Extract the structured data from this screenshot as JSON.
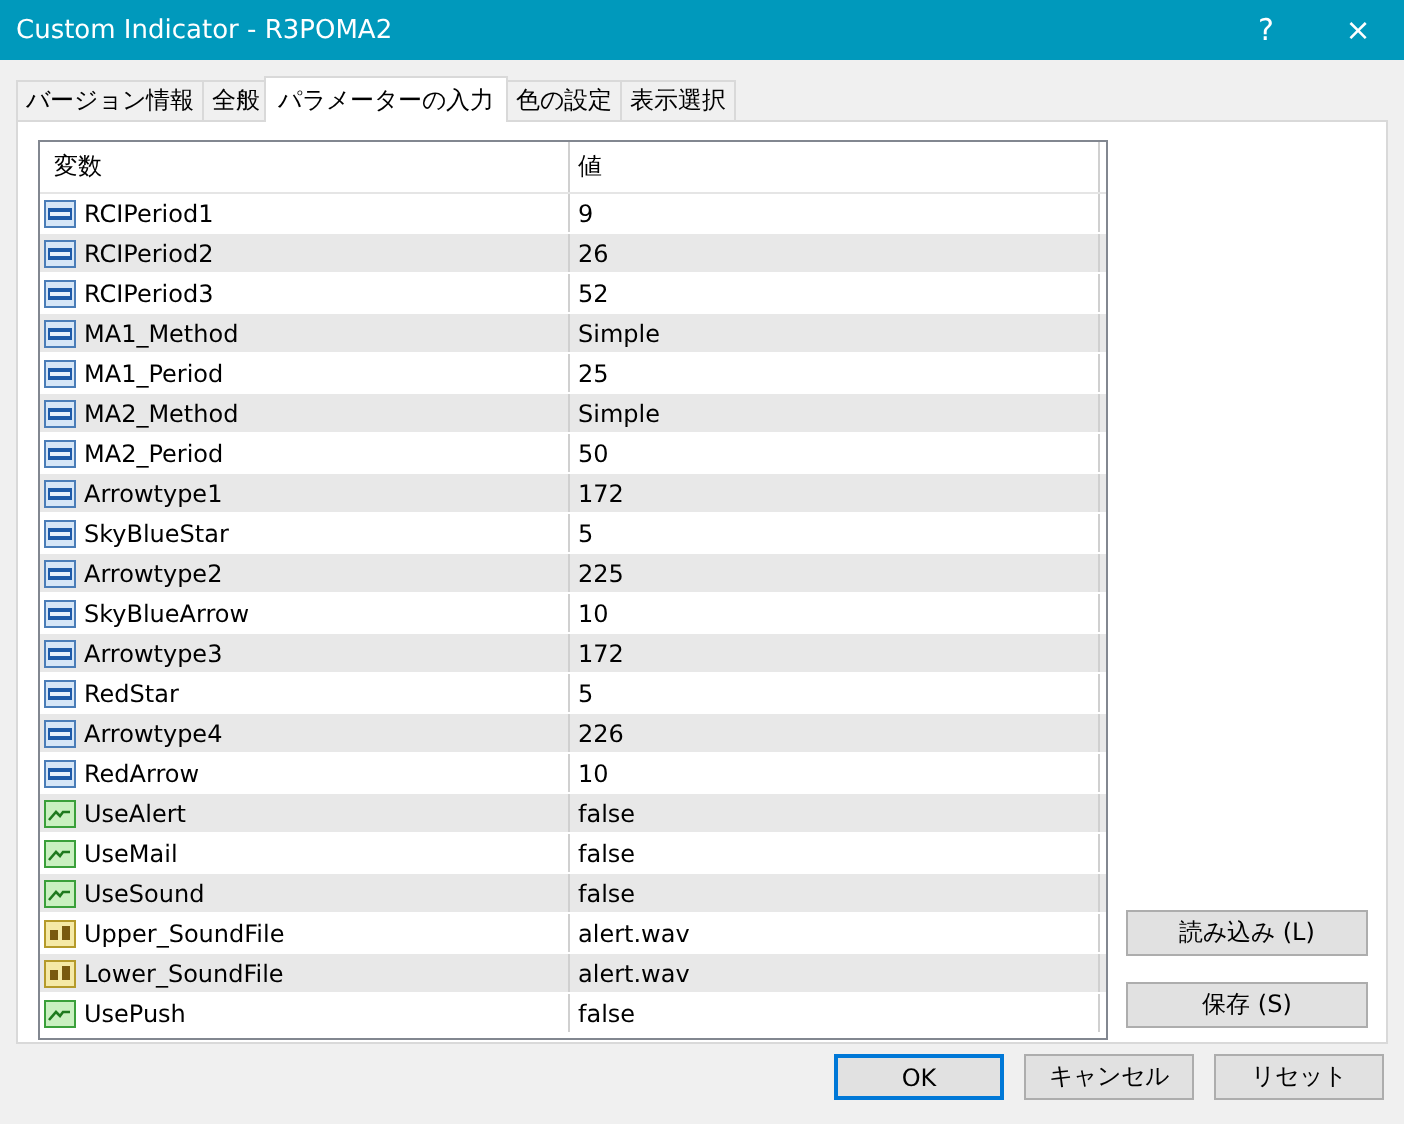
{
  "window": {
    "title": "Custom Indicator - R3POMA2",
    "help": "?",
    "close": "×"
  },
  "tabs": [
    {
      "label": "バージョン情報",
      "selected": false
    },
    {
      "label": "全般",
      "selected": false
    },
    {
      "label": "パラメーターの入力",
      "selected": true
    },
    {
      "label": "色の設定",
      "selected": false
    },
    {
      "label": "表示選択",
      "selected": false
    }
  ],
  "table": {
    "columns": [
      "変数",
      "値"
    ],
    "rows": [
      {
        "kind": "number",
        "name": "RCIPeriod1",
        "value": "9"
      },
      {
        "kind": "number",
        "name": "RCIPeriod2",
        "value": "26"
      },
      {
        "kind": "number",
        "name": "RCIPeriod3",
        "value": "52"
      },
      {
        "kind": "number",
        "name": "MA1_Method",
        "value": "Simple"
      },
      {
        "kind": "number",
        "name": "MA1_Period",
        "value": "25"
      },
      {
        "kind": "number",
        "name": "MA2_Method",
        "value": "Simple"
      },
      {
        "kind": "number",
        "name": "MA2_Period",
        "value": "50"
      },
      {
        "kind": "number",
        "name": "Arrowtype1",
        "value": "172"
      },
      {
        "kind": "number",
        "name": "SkyBlueStar",
        "value": "5"
      },
      {
        "kind": "number",
        "name": "Arrowtype2",
        "value": "225"
      },
      {
        "kind": "number",
        "name": "SkyBlueArrow",
        "value": "10"
      },
      {
        "kind": "number",
        "name": "Arrowtype3",
        "value": "172"
      },
      {
        "kind": "number",
        "name": "RedStar",
        "value": "5"
      },
      {
        "kind": "number",
        "name": "Arrowtype4",
        "value": "226"
      },
      {
        "kind": "number",
        "name": "RedArrow",
        "value": "10"
      },
      {
        "kind": "bool",
        "name": "UseAlert",
        "value": "false"
      },
      {
        "kind": "bool",
        "name": "UseMail",
        "value": "false"
      },
      {
        "kind": "bool",
        "name": "UseSound",
        "value": "false"
      },
      {
        "kind": "text",
        "name": "Upper_SoundFile",
        "value": "alert.wav"
      },
      {
        "kind": "text",
        "name": "Lower_SoundFile",
        "value": "alert.wav"
      },
      {
        "kind": "bool",
        "name": "UsePush",
        "value": "false"
      }
    ]
  },
  "side_buttons": [
    "読み込み (L)",
    "保存 (S)"
  ],
  "buttons": [
    {
      "label": "OK",
      "default": true
    },
    {
      "label": "キャンセル",
      "default": false
    },
    {
      "label": "リセット",
      "default": false
    }
  ]
}
